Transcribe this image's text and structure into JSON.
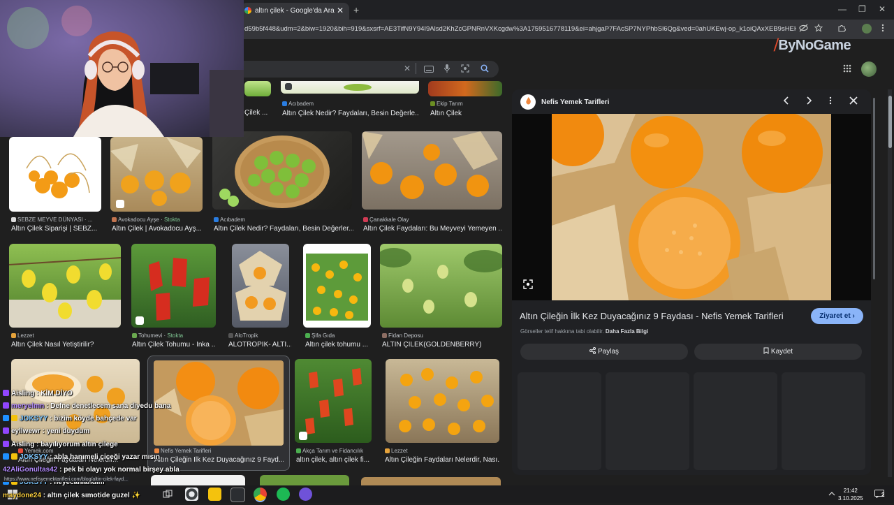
{
  "browser": {
    "tab_title": "altın çilek - Google'da Ara",
    "url": "d59b5f448&udm=2&biw=1920&bih=919&sxsrf=AE3TifN9Y94I9Alsd2KhZcGPNRnVXKcgdw%3A1759516778119&ei=ahjgaP7FAcSP7NYPhbSl6Qg&ved=0ahUKEwj-op_k1oiQAxXEB9sHEHQVaK...",
    "new_tab": "+",
    "minimize": "—",
    "restore": "❐",
    "close": "✕"
  },
  "watermark": {
    "prefix": "",
    "brand": "ByNoGame"
  },
  "search": {
    "clear": "✕"
  },
  "top_row": [
    {
      "source": "Acıbadem",
      "caption": "Altın Çilek Nedir? Faydaları, Besin Değerle..."
    },
    {
      "source": "Ekip Tarım",
      "caption": "Altın Çilek"
    }
  ],
  "top_row_partial_caption": "Çilek ...",
  "results": [
    {
      "source": "SEBZE MEYVE DÜNYASI · ...",
      "caption": "Altın Çilek Siparişi | SEBZ...",
      "stock": ""
    },
    {
      "source": "Avokadocu Ayşe",
      "caption": "Altın Çilek | Avokadocu Ayş...",
      "stock": "Stokta"
    },
    {
      "source": "Acıbadem",
      "caption": "Altın Çilek Nedir? Faydaları, Besin Değerler...",
      "stock": ""
    },
    {
      "source": "Çanakkale Olay",
      "caption": "Altın Çilek Faydaları: Bu Meyveyi Yemeyen ...",
      "stock": ""
    },
    {
      "source": "Lezzet",
      "caption": "Altın Çilek Nasıl Yetiştirilir?",
      "stock": ""
    },
    {
      "source": "Tohumevi",
      "caption": "Altın Çilek Tohumu - İnka ...",
      "stock": "Stokta"
    },
    {
      "source": "AloTropik",
      "caption": "ALOTROPİK- ALTI...",
      "stock": ""
    },
    {
      "source": "Şifa Gıda",
      "caption": "Altın çilek tohumu ...",
      "stock": ""
    },
    {
      "source": "Fidan Deposu",
      "caption": "ALTIN ÇİLEK(GOLDENBERRY)",
      "stock": ""
    },
    {
      "source": "Yemek.com",
      "caption": "Altın Çileğin Faydaları Nelerdir...",
      "stock": ""
    },
    {
      "source": "Nefis Yemek Tarifleri",
      "caption": "Altın Çileğin İlk Kez Duyacağınız 9 Fayd...",
      "stock": ""
    },
    {
      "source": "Akça Tarım ve Fidancılık",
      "caption": "altın çilek, altın çilek fi...",
      "stock": ""
    },
    {
      "source": "Lezzet",
      "caption": "Altın Çileğin Faydaları Nelerdir, Nası...",
      "stock": ""
    }
  ],
  "panel": {
    "source": "Nefis Yemek Tarifleri",
    "title": "Altın Çileğin İlk Kez Duyacağınız 9 Faydası - Nefis Yemek Tarifleri",
    "visit": "Ziyaret et",
    "visit_arrow": "›",
    "copyright": "Görseller telif hakkına tabi olabilir.",
    "more_info": "Daha Fazla Bilgi",
    "share": "Paylaş",
    "save": "Kaydet"
  },
  "status_url": "https://www.nefisyemektarifleri.com/blog/altin-cilek-fayd...",
  "chat": [
    {
      "user": "Aisling",
      "message": "KİM DİYO",
      "color": "#ffffff"
    },
    {
      "user": "meryelmn",
      "message": "Defne denetlecem sana diyedu bana",
      "color": "#b58cff"
    },
    {
      "user": "JOKSYY",
      "message": "bizim köyde bahçede var",
      "color": "#7ec7ff"
    },
    {
      "user": "eyllwewr",
      "message": "yeni duydum",
      "color": "#ffffff"
    },
    {
      "user": "Aisling",
      "message": "bayılıyorum altın çilege",
      "color": "#ffffff"
    },
    {
      "user": "JOKSYY",
      "message": "abla hanımeli çiçeği yazar mısın",
      "color": "#7ec7ff"
    },
    {
      "user": "42AliGonultas42",
      "message": "pek bi olayı yok normal birşey abla",
      "color": "#b58cff"
    },
    {
      "user": "JOKSYY",
      "message": "heyecanlandım",
      "color": "#7ec7ff"
    },
    {
      "user": "maydone24",
      "message": "altın çilek sımotide guzel",
      "color": "#ffd23f"
    }
  ],
  "chat_sep": " : ",
  "chat_emoji": "✨",
  "clock": {
    "time": "21:42",
    "date": "3.10.2025"
  },
  "notifications_count": "2"
}
